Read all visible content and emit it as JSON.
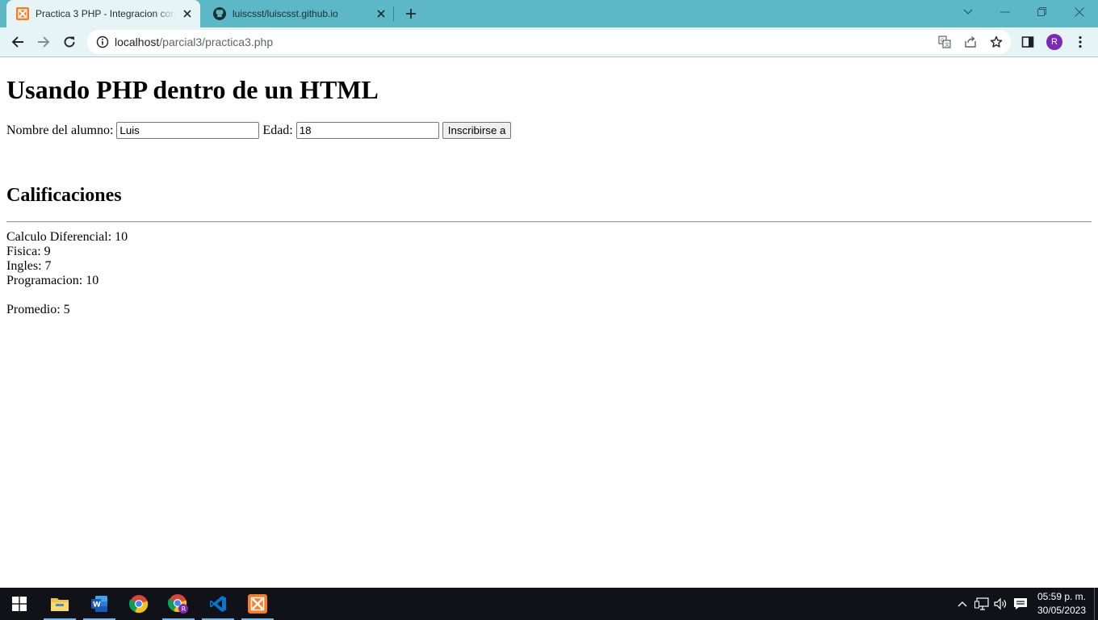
{
  "browser": {
    "tabs": [
      {
        "title": "Practica 3 PHP - Integracion con",
        "active": true,
        "favicon": "xampp-icon"
      },
      {
        "title": "luiscsst/luiscsst.github.io",
        "active": false,
        "favicon": "github-icon"
      }
    ],
    "address": {
      "host": "localhost",
      "path": "/parcial3/practica3.php"
    },
    "profile_initial": "R",
    "colors": {
      "tabstrip": "#5cb8c6",
      "toolbar": "#e6f4f6",
      "avatar": "#7b2ab7"
    }
  },
  "page": {
    "heading": "Usando PHP dentro de un HTML",
    "form": {
      "name_label": "Nombre del alumno:",
      "name_value": "Luis",
      "age_label": "Edad:",
      "age_value": "18",
      "submit_label": "Inscribirse a"
    },
    "grades_heading": "Calificaciones",
    "grades": [
      "Calculo Diferencial: 10",
      "Fisica: 9",
      "Ingles: 7",
      "Programacion: 10"
    ],
    "average": "Promedio: 5"
  },
  "taskbar": {
    "apps": [
      "start-icon",
      "file-explorer-icon",
      "word-icon",
      "chrome-icon",
      "chrome-profile-icon",
      "vscode-icon",
      "xampp-icon"
    ],
    "time": "05:59 p. m.",
    "date": "30/05/2023"
  }
}
